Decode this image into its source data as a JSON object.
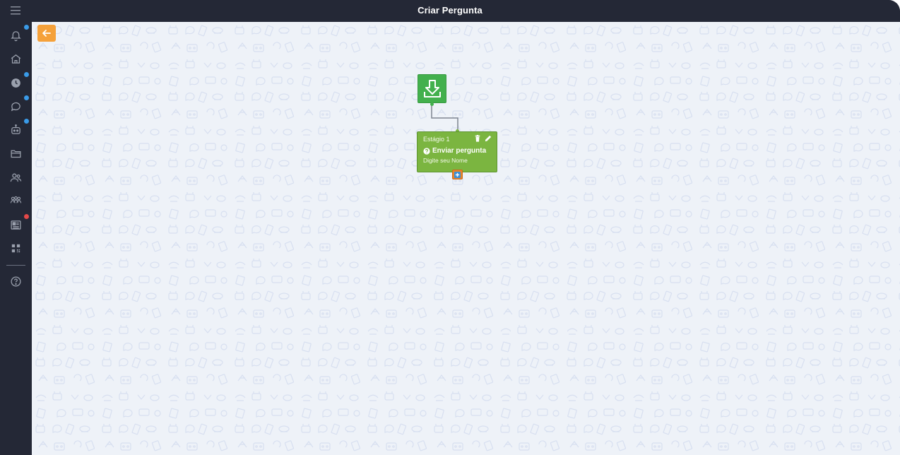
{
  "header": {
    "title": "Criar Pergunta"
  },
  "sidebar": {
    "items": [
      {
        "name": "notifications",
        "icon": "bell-icon",
        "badge_color": "#3a9be8"
      },
      {
        "name": "home",
        "icon": "home-icon"
      },
      {
        "name": "history",
        "icon": "clock-icon",
        "badge_color": "#3a9be8"
      },
      {
        "name": "chat",
        "icon": "chat-bubble-icon",
        "badge_color": "#3a9be8"
      },
      {
        "name": "bot",
        "icon": "robot-icon",
        "badge_color": "#3a9be8"
      },
      {
        "name": "folders",
        "icon": "folder-icon"
      },
      {
        "name": "contacts",
        "icon": "users-icon"
      },
      {
        "name": "groups",
        "icon": "team-icon"
      },
      {
        "name": "reports",
        "icon": "newspaper-icon",
        "badge_color": "#e34848"
      },
      {
        "name": "qrcode",
        "icon": "qrcode-icon"
      },
      {
        "name": "help",
        "icon": "help-circle-icon"
      }
    ]
  },
  "flow": {
    "start_node_icon": "download-tray-icon",
    "stage": {
      "label": "Estágio 1",
      "type": "Enviar pergunta",
      "description": "Digite seu Nome"
    }
  },
  "colors": {
    "sidebar_bg": "#242836",
    "canvas_bg": "#eef2f8",
    "accent_orange": "#f5a13a",
    "start_green": "#43b04d",
    "stage_green": "#7bb540"
  }
}
